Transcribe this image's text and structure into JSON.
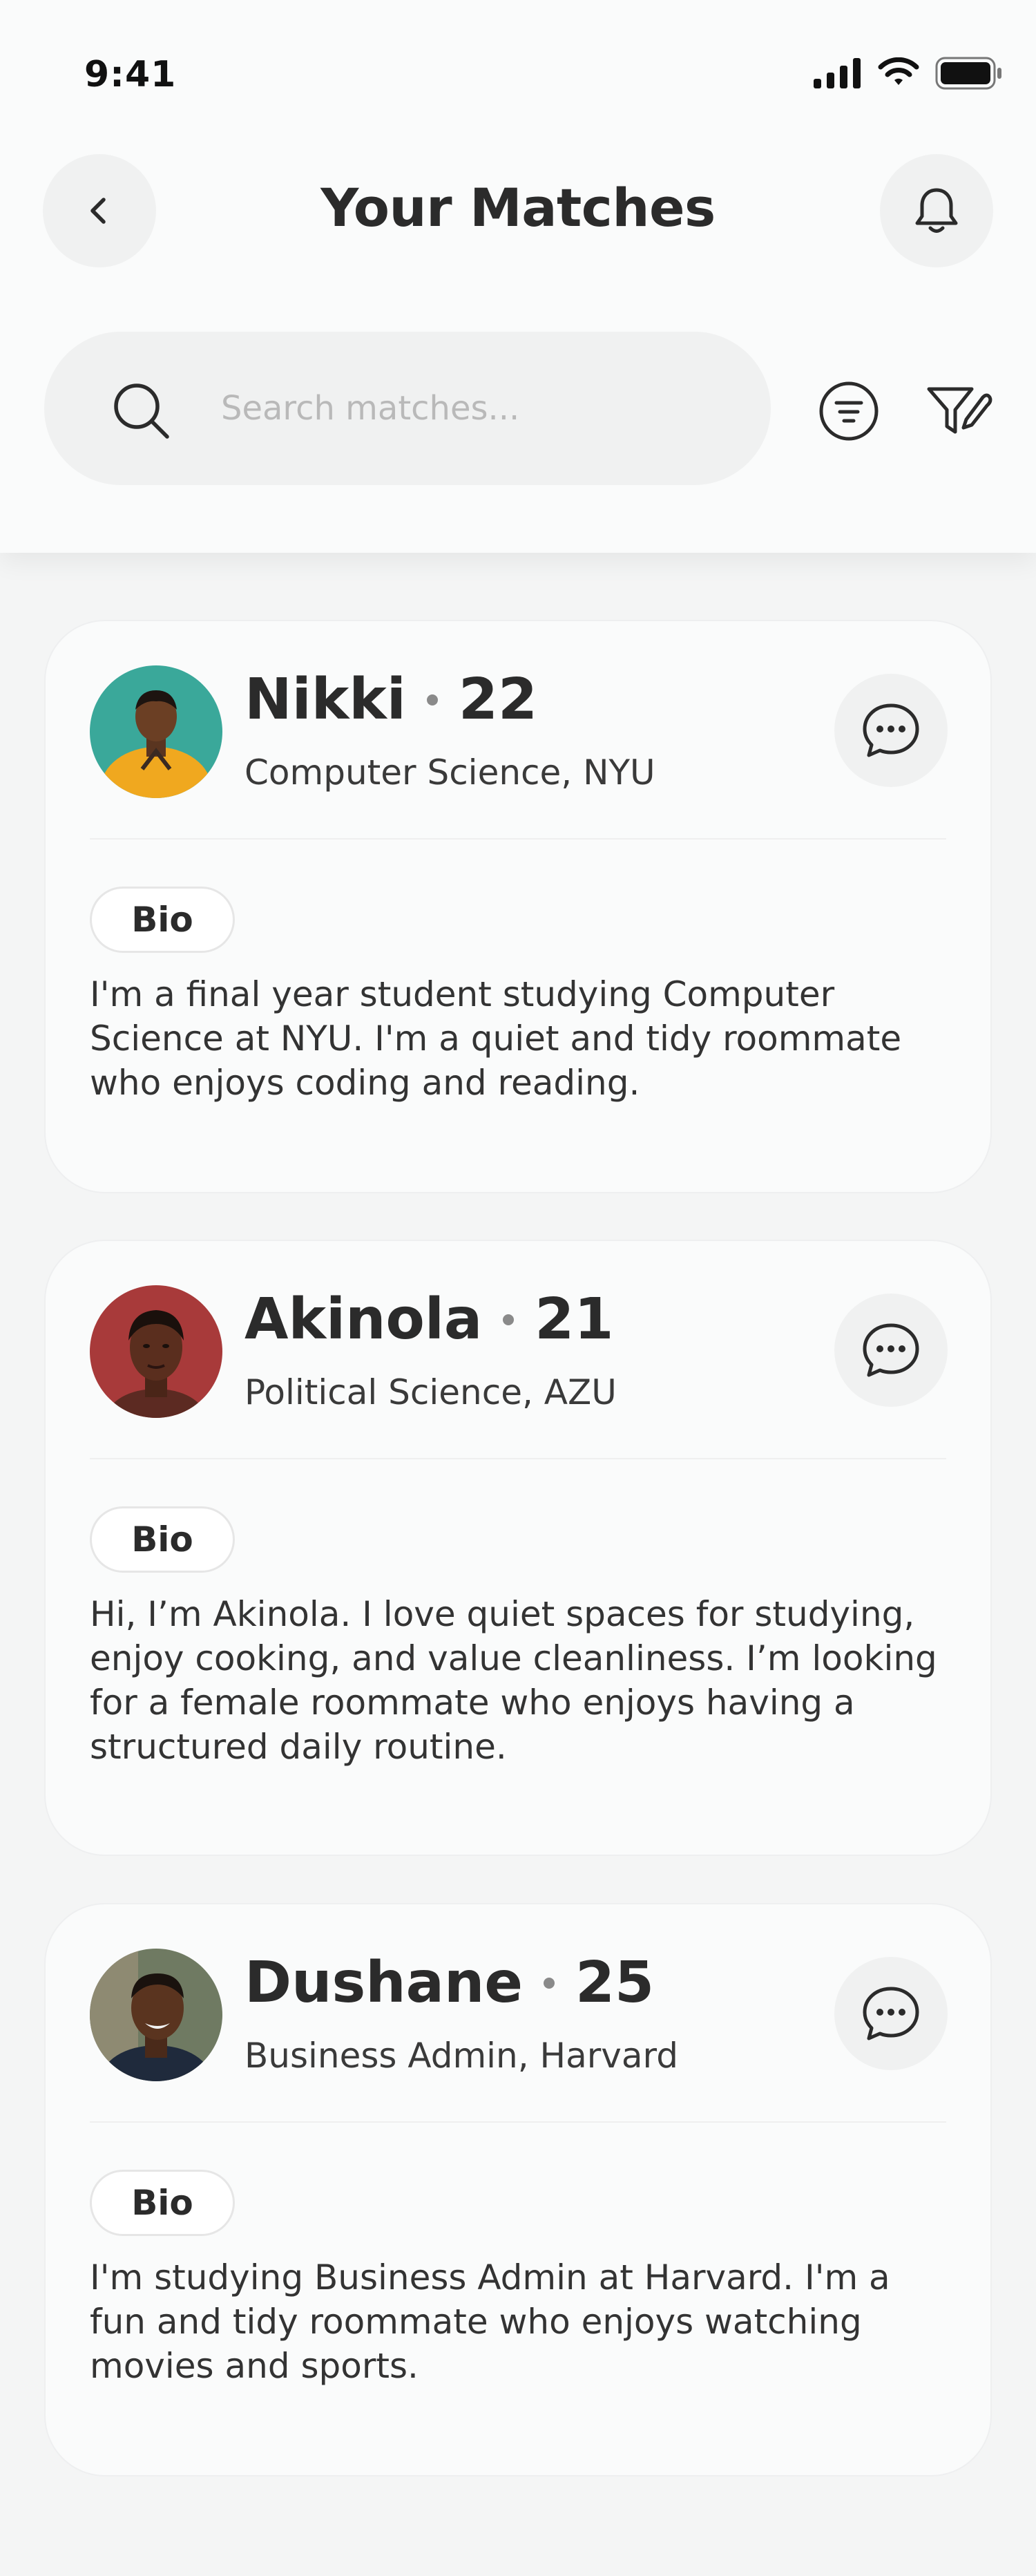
{
  "status_bar": {
    "time": "9:41"
  },
  "header": {
    "title": "Your Matches",
    "search_placeholder": "Search matches..."
  },
  "icons": {
    "back": "chevron-left-icon",
    "notifications": "bell-icon",
    "search": "search-icon",
    "sort": "sort-lines-icon",
    "filter": "filter-icon",
    "chat": "chat-bubble-icon"
  },
  "matches": [
    {
      "name": "Nikki",
      "age": "22",
      "school": "Computer Science, NYU",
      "bio_label": "Bio",
      "bio": "I'm a final year student studying Computer Science at NYU. I'm a quiet and tidy roommate who enjoys coding and reading."
    },
    {
      "name": "Akinola",
      "age": "21",
      "school": "Political Science, AZU",
      "bio_label": "Bio",
      "bio": "Hi, I’m Akinola. I love quiet spaces for studying, enjoy cooking, and value cleanliness. I’m looking for a female roommate who enjoys having a structured daily routine."
    },
    {
      "name": "Dushane",
      "age": "25",
      "school": "Business Admin, Harvard",
      "bio_label": "Bio",
      "bio": "I'm studying Business Admin at Harvard. I'm a fun and tidy roommate who enjoys watching movies and sports."
    }
  ],
  "colors": {
    "background": "#f4f5f5",
    "card": "#fafbfb",
    "text": "#2b2b2b",
    "placeholder": "#b9b9b9"
  }
}
